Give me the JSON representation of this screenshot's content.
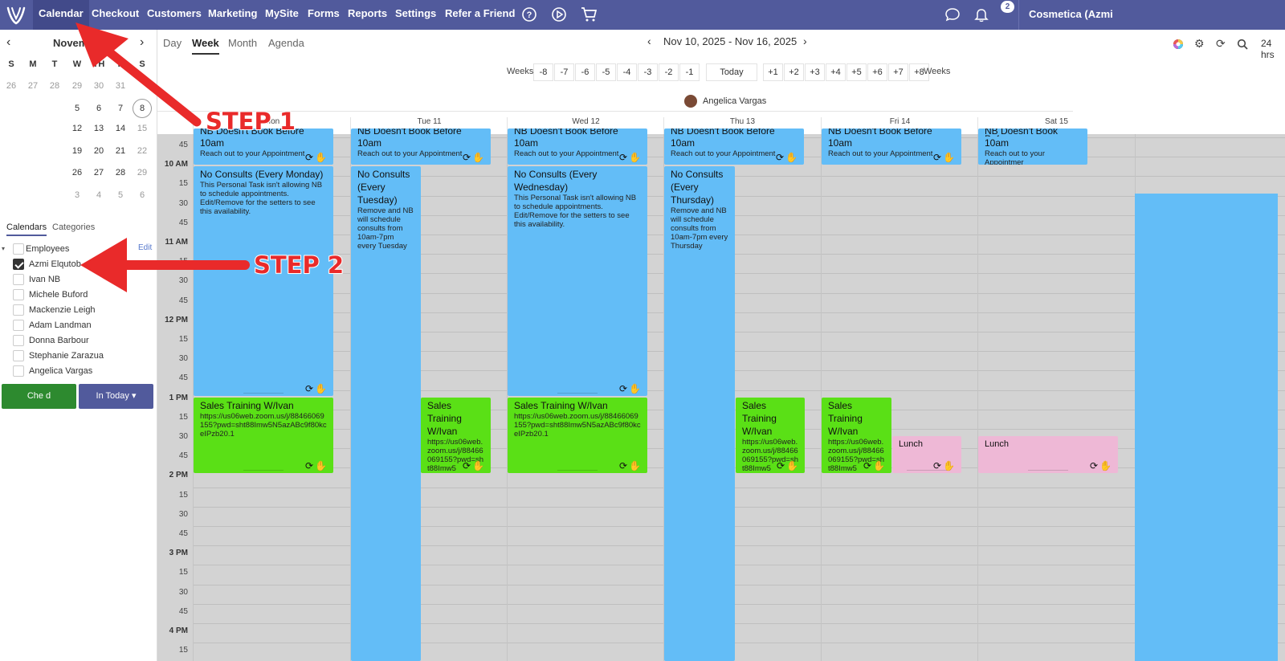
{
  "topnav": {
    "items": [
      "Calendar",
      "Checkout",
      "Customers",
      "Marketing",
      "MySite",
      "Forms",
      "Reports",
      "Settings",
      "Refer a Friend"
    ],
    "notification_count": "2",
    "account_name": "Cosmetica (Azmi"
  },
  "mini_calendar": {
    "title": "Novem",
    "weekday_headers": [
      "S",
      "M",
      "T",
      "W",
      "TH",
      "F",
      "S"
    ],
    "rows": [
      [
        "26",
        "27",
        "28",
        "29",
        "30",
        "31",
        ""
      ],
      [
        "",
        "",
        "",
        "5",
        "6",
        "7",
        "8"
      ],
      [
        "",
        "",
        "",
        "12",
        "13",
        "14",
        "15"
      ],
      [
        "",
        "",
        "",
        "19",
        "20",
        "21",
        "22"
      ],
      [
        "",
        "",
        "",
        "26",
        "27",
        "28",
        "29"
      ],
      [
        "",
        "",
        "",
        "3",
        "4",
        "5",
        "6"
      ]
    ]
  },
  "sidebar": {
    "tabs": [
      "Calendars",
      "Categories"
    ],
    "group_label": "Employees",
    "edit_label": "Edit",
    "employees": [
      {
        "name": "Azmi Elqutob",
        "checked": true
      },
      {
        "name": "Ivan NB",
        "checked": false
      },
      {
        "name": "Michele Buford",
        "checked": false
      },
      {
        "name": "Mackenzie Leigh",
        "checked": false
      },
      {
        "name": "Adam Landman",
        "checked": false
      },
      {
        "name": "Donna Barbour",
        "checked": false
      },
      {
        "name": "Stephanie Zarazua",
        "checked": false
      },
      {
        "name": "Angelica Vargas",
        "checked": false
      }
    ],
    "checkin_label": "Che   d",
    "in_today_label": "In Today ▾"
  },
  "toolbar": {
    "views": [
      "Day",
      "Week",
      "Month",
      "Agenda"
    ],
    "active_view": "Week",
    "date_range": "Nov 10, 2025 - Nov 16, 2025",
    "hours_label": "24 hrs",
    "weeks_label": "Weeks",
    "week_jumps": [
      "-8",
      "-7",
      "-6",
      "-5",
      "-4",
      "-3",
      "-2",
      "-1",
      "Today",
      "+1",
      "+2",
      "+3",
      "+4",
      "+5",
      "+6",
      "+7",
      "+8"
    ]
  },
  "calendar": {
    "owner": "Angelica Vargas",
    "day_headers": [
      "Mon",
      "Tue 11",
      "Wed 12",
      "Thu 13",
      "Fri 14",
      "Sat 15"
    ],
    "time_labels": [
      "45",
      "10 AM",
      "15",
      "30",
      "45",
      "11 AM",
      "15",
      "30",
      "45",
      "12 PM",
      "15",
      "30",
      "45",
      "1 PM",
      "15",
      "30",
      "45",
      "2 PM",
      "15",
      "30",
      "45",
      "3 PM",
      "15",
      "30",
      "45",
      "4 PM",
      "15"
    ],
    "hour_labels": [
      "10 AM",
      "11 AM",
      "12 PM",
      "1 PM",
      "2 PM",
      "3 PM",
      "4 PM"
    ],
    "events": {
      "nb_title_top": "NB Doesn't Book Before",
      "nb_title": "10am",
      "nb_desc": "Reach out to your Appointment",
      "nb_desc_sat": "Reach out to your Appointmer",
      "consult_mon_title": "No Consults (Every Monday)",
      "consult_wed_title": "No Consults (Every Wednesday)",
      "consult_desc": "This Personal Task isn't allowing NB to schedule appointments. Edit/Remove for the setters to see this availability.",
      "consult_tue_title": "No Consults (Every Tuesday)",
      "consult_thu_title": "No Consults (Every Thursday)",
      "consult_short_desc_tue": "Remove and NB will schedule consults from 10am-7pm every Tuesday",
      "consult_short_desc_thu": "Remove and NB will schedule consults from 10am-7pm every Thursday",
      "sales_title": "Sales Training W/Ivan",
      "sales_link": "https://us06web.zoom.us/j/88466069155?pwd=sht88Imw5N5azABc9f80kceIPzb20.1",
      "sales_short_title": "Sales Training W/Ivan",
      "sales_short_link": "https://us06web.zoom.us/j/88466069155?pwd=sht88Imw5",
      "lunch_title": "Lunch",
      "icons": "⟳✋"
    }
  },
  "annotations": {
    "step1": "STEP 1",
    "step2": "STEP 2",
    "arrow_color": "#e92a2a"
  },
  "colors": {
    "nav": "#515a9c",
    "blocked": "#63bdf7",
    "training": "#5ae016",
    "lunch": "#eeb8d6",
    "grid": "#d3d3d3"
  }
}
